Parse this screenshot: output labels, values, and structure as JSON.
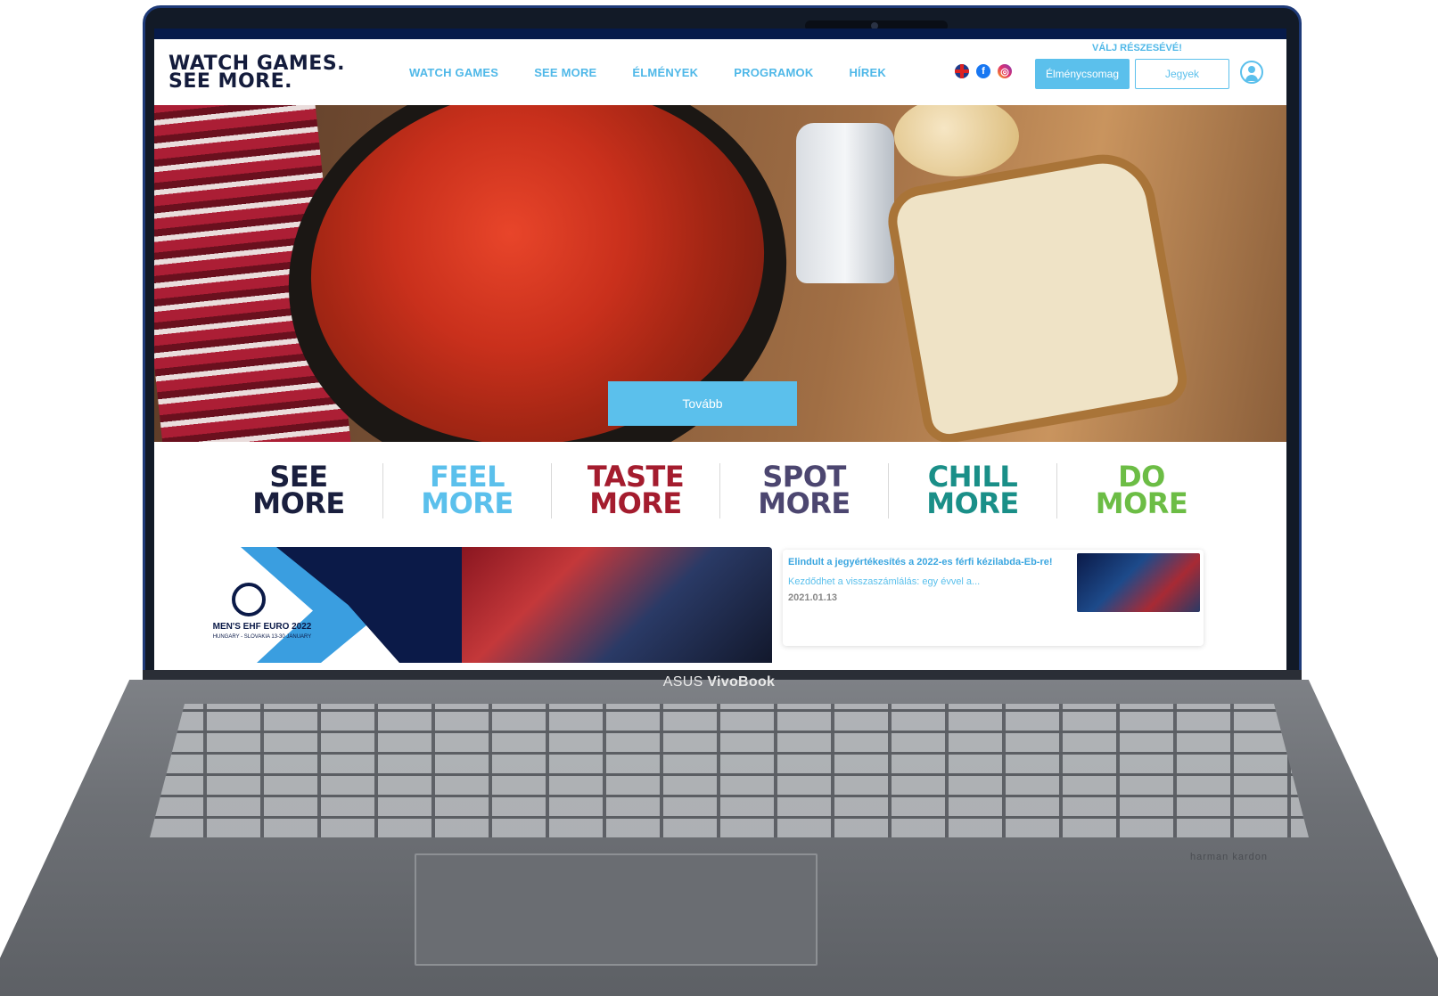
{
  "device": {
    "brand_prefix": "ASUS",
    "brand_model": "VivoBook",
    "speaker_brand": "harman kardon"
  },
  "header": {
    "logo_line1": "WATCH GAMES.",
    "logo_line2": "SEE MORE.",
    "nav": [
      "WATCH GAMES",
      "SEE MORE",
      "ÉLMÉNYEK",
      "PROGRAMOK",
      "HÍREK"
    ],
    "icons": [
      "uk-flag-icon",
      "facebook-icon",
      "instagram-icon"
    ],
    "cta_caption": "VÁLJ RÉSZESÉVÉ!",
    "btn_primary": "Élménycsomag",
    "btn_secondary": "Jegyek",
    "user_icon": "user-icon"
  },
  "hero": {
    "button": "Tovább"
  },
  "mores": [
    {
      "line1": "SEE",
      "line2": "MORE",
      "color": "#1a1f3e"
    },
    {
      "line1": "FEEL",
      "line2": "MORE",
      "color": "#5bc0ec"
    },
    {
      "line1": "TASTE",
      "line2": "MORE",
      "color": "#a41c2e"
    },
    {
      "line1": "SPOT",
      "line2": "MORE",
      "color": "#4c4670"
    },
    {
      "line1": "CHILL",
      "line2": "MORE",
      "color": "#1a8f88"
    },
    {
      "line1": "DO",
      "line2": "MORE",
      "color": "#6cbd45"
    }
  ],
  "banner": {
    "title": "MEN'S EHF EURO 2022",
    "sub": "HUNGARY - SLOVAKIA 13-30 JANUARY"
  },
  "news": {
    "title": "Elindult a jegyértékesítés a 2022-es férfi kézilabda-Eb-re!",
    "excerpt": "Kezdődhet a visszaszámlálás: egy évvel a...",
    "date": "2021.01.13"
  },
  "colors": {
    "accent": "#5bc0ec",
    "navy": "#061a4a"
  }
}
